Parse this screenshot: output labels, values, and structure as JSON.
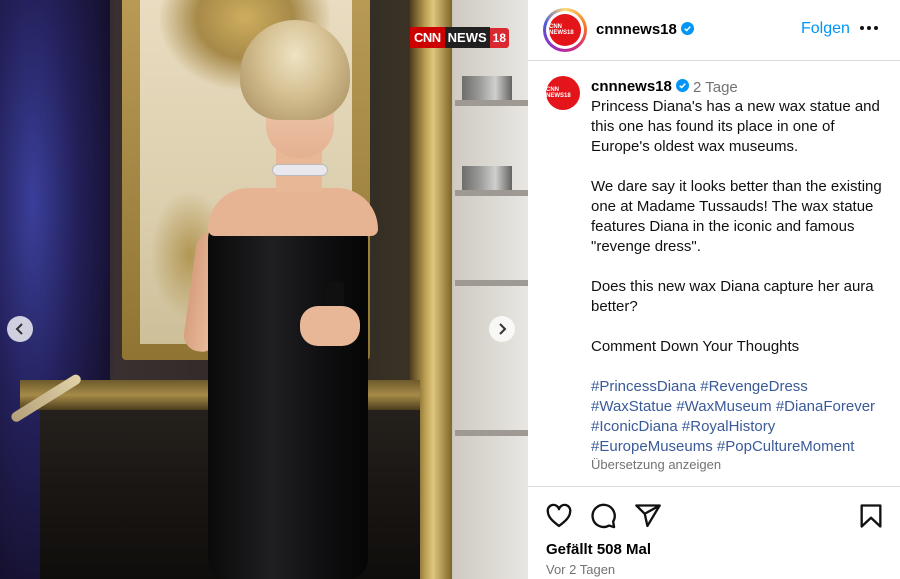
{
  "media": {
    "watermark": {
      "part1": "CNN",
      "part2": "NEWS",
      "part3": "18"
    },
    "prev_icon": "chevron-left-icon",
    "next_icon": "chevron-right-icon"
  },
  "header": {
    "username": "cnnnews18",
    "avatar_text": "CNN NEWS18",
    "follow_label": "Folgen",
    "more_icon": "more-horizontal-icon"
  },
  "caption": {
    "username": "cnnnews18",
    "time_ago": "2 Tage",
    "paragraphs": [
      "Princess Diana's has a new wax statue and this one has found its place in one of Europe's oldest wax museums.",
      "We dare say it looks better than the existing one at Madame Tussauds! The wax statue features Diana in the iconic and famous \"revenge dress\".",
      "Does this new wax Diana capture her aura better?",
      "Comment Down Your Thoughts"
    ],
    "hashtags": [
      "#PrincessDiana",
      "#RevengeDress",
      "#WaxStatue",
      "#WaxMuseum",
      "#DianaForever",
      "#IconicDiana",
      "#RoyalHistory",
      "#EuropeMuseums",
      "#PopCultureMoment"
    ],
    "translate_label": "Übersetzung anzeigen"
  },
  "actions": {
    "like_icon": "heart-icon",
    "comment_icon": "comment-icon",
    "share_icon": "send-icon",
    "save_icon": "bookmark-icon"
  },
  "likes_text": "Gefällt 508 Mal",
  "date_text": "Vor 2 Tagen",
  "colors": {
    "link_blue": "#0095f6",
    "hashtag_blue": "#3a5a99",
    "muted_gray": "#737373",
    "verified_blue": "#0095f6",
    "brand_red": "#e3151b"
  }
}
